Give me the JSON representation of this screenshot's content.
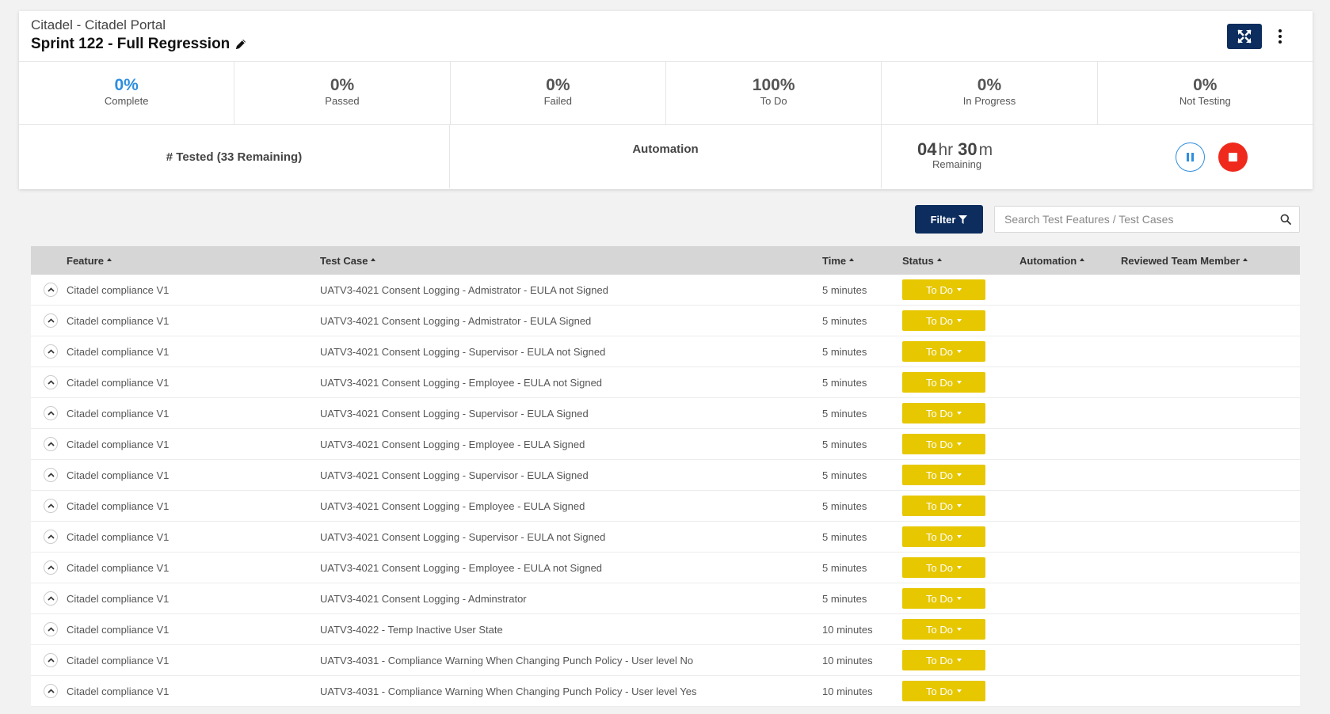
{
  "header": {
    "project": "Citadel - Citadel Portal",
    "sprint_title": "Sprint 122 - Full Regression"
  },
  "stats": [
    {
      "value": "0%",
      "label": "Complete",
      "color": "#2e8ede"
    },
    {
      "value": "0%",
      "label": "Passed"
    },
    {
      "value": "0%",
      "label": "Failed"
    },
    {
      "value": "100%",
      "label": "To Do"
    },
    {
      "value": "0%",
      "label": "In Progress"
    },
    {
      "value": "0%",
      "label": "Not Testing"
    }
  ],
  "summary": {
    "tested": "# Tested (33 Remaining)",
    "automation": "Automation",
    "hours": "04",
    "hours_unit": "hr",
    "minutes": "30",
    "minutes_unit": "m",
    "remaining_label": "Remaining"
  },
  "toolbar": {
    "filter_label": "Filter",
    "search_placeholder": "Search Test Features / Test Cases"
  },
  "table": {
    "columns": {
      "feature": "Feature",
      "test_case": "Test Case",
      "time": "Time",
      "status": "Status",
      "automation": "Automation",
      "reviewed": "Reviewed Team Member"
    },
    "rows": [
      {
        "feature": "Citadel compliance V1",
        "test_case": "UATV3-4021 Consent Logging - Admistrator - EULA not Signed",
        "time": "5 minutes",
        "status": "To Do"
      },
      {
        "feature": "Citadel compliance V1",
        "test_case": "UATV3-4021 Consent Logging - Admistrator - EULA Signed",
        "time": "5 minutes",
        "status": "To Do"
      },
      {
        "feature": "Citadel compliance V1",
        "test_case": "UATV3-4021 Consent Logging - Supervisor - EULA not Signed",
        "time": "5 minutes",
        "status": "To Do"
      },
      {
        "feature": "Citadel compliance V1",
        "test_case": "UATV3-4021 Consent Logging - Employee - EULA not Signed",
        "time": "5 minutes",
        "status": "To Do"
      },
      {
        "feature": "Citadel compliance V1",
        "test_case": "UATV3-4021 Consent Logging - Supervisor - EULA Signed",
        "time": "5 minutes",
        "status": "To Do"
      },
      {
        "feature": "Citadel compliance V1",
        "test_case": "UATV3-4021 Consent Logging - Employee - EULA Signed",
        "time": "5 minutes",
        "status": "To Do"
      },
      {
        "feature": "Citadel compliance V1",
        "test_case": "UATV3-4021 Consent Logging - Supervisor - EULA Signed",
        "time": "5 minutes",
        "status": "To Do"
      },
      {
        "feature": "Citadel compliance V1",
        "test_case": "UATV3-4021 Consent Logging - Employee - EULA Signed",
        "time": "5 minutes",
        "status": "To Do"
      },
      {
        "feature": "Citadel compliance V1",
        "test_case": "UATV3-4021 Consent Logging - Supervisor - EULA not Signed",
        "time": "5 minutes",
        "status": "To Do"
      },
      {
        "feature": "Citadel compliance V1",
        "test_case": "UATV3-4021 Consent Logging - Employee - EULA not Signed",
        "time": "5 minutes",
        "status": "To Do"
      },
      {
        "feature": "Citadel compliance V1",
        "test_case": "UATV3-4021 Consent Logging - Adminstrator",
        "time": "5 minutes",
        "status": "To Do"
      },
      {
        "feature": "Citadel compliance V1",
        "test_case": "UATV3-4022 - Temp Inactive User State",
        "time": "10 minutes",
        "status": "To Do"
      },
      {
        "feature": "Citadel compliance V1",
        "test_case": "UATV3-4031 - Compliance Warning When Changing Punch Policy - User level No",
        "time": "10 minutes",
        "status": "To Do"
      },
      {
        "feature": "Citadel compliance V1",
        "test_case": "UATV3-4031 - Compliance Warning When Changing Punch Policy - User level Yes",
        "time": "10 minutes",
        "status": "To Do"
      }
    ]
  },
  "colors": {
    "navy": "#0c2d5e",
    "blue": "#2e8ede",
    "red": "#ef2a1d",
    "status_yellow": "#e6c700"
  }
}
